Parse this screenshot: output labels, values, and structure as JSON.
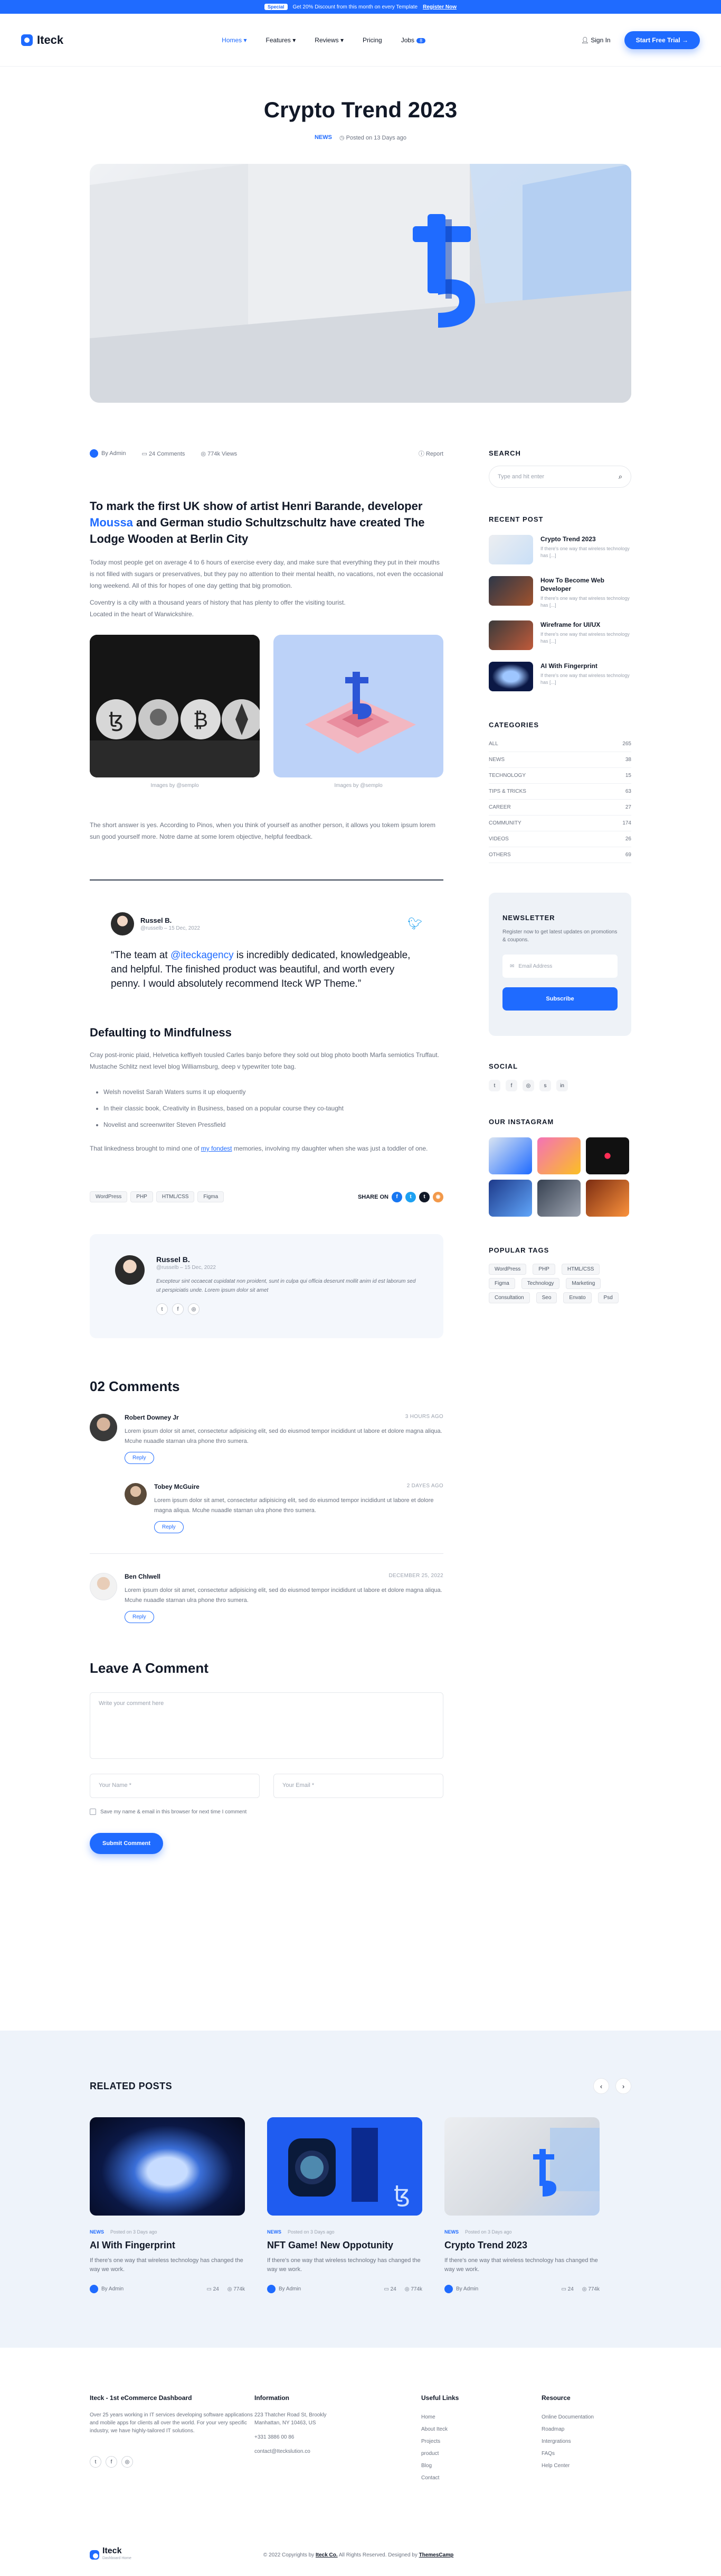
{
  "topbar": {
    "pill": "Special",
    "promo": "Get 20% Discount from this month on every Template",
    "cta": "Register Now"
  },
  "header": {
    "logo": "Iteck",
    "nav": [
      "Homes",
      "Features",
      "Reviews",
      "Pricing",
      "Jobs"
    ],
    "jobs_badge": "8",
    "signin": "Sign In",
    "cta": "Start Free Trial"
  },
  "post": {
    "title": "Crypto Trend 2023",
    "category": "NEWS",
    "posted": "Posted on 13 Days ago",
    "author": "By Admin",
    "comments": "24 Comments",
    "views": "774k Views",
    "report": "Report",
    "lead_a": "To mark the first UK show of artist Henri Barande, developer ",
    "lead_hl": "Moussa",
    "lead_b": " and German studio Schultzschultz have created The Lodge Wooden at Berlin City",
    "p1": "Today most people get on average 4 to 6 hours of exercise every day, and make sure that everything they put in their mouths is not filled with sugars or preservatives, but they pay no attention to their mental health, no vacations, not even the occasional long weekend. All of this for hopes of one day getting that big promotion.",
    "p2": "Coventry is a city with a thousand years of history that has plenty to offer the visiting tourist.",
    "p3": "Located in the heart of Warwickshire.",
    "caption1": "Images by @semplo",
    "caption2": "Images by @semplo",
    "p4": "The short answer is yes. According to Pinos, when you think of yourself as another person, it allows you tokem ipsum lorem sun good yourself more. Notre dame at some lorem objective, helpful feedback.",
    "quote_name": "Russel B.",
    "quote_sub": "@russelb – 15 Dec, 2022",
    "quote_a": "“The team at ",
    "quote_hl": "@iteckagency",
    "quote_b": " is incredibly dedicated, knowledgeable, and helpful. The finished product was beautiful, and worth every penny. I would absolutely recommend Iteck WP Theme.”",
    "section2": "Defaulting to Mindfulness",
    "p5": "Cray post-ironic plaid, Helvetica keffiyeh tousled Carles banjo before they sold out blog photo booth Marfa semiotics Truffaut. Mustache Schlitz next level blog Williamsburg, deep v typewriter tote bag.",
    "bullets": [
      "Welsh novelist Sarah Waters sums it up eloquently",
      "In their classic book, Creativity in Business, based on a popular course they co-taught",
      "Novelist and screenwriter Steven Pressfield"
    ],
    "p6_a": "That linkedness brought to mind one of ",
    "p6_link": "my fondest",
    "p6_b": " memories, involving my daughter when she was just a toddler of one.",
    "tags": [
      "WordPress",
      "PHP",
      "HTML/CSS",
      "Figma"
    ],
    "share_label": "SHARE ON",
    "author_box": {
      "name": "Russel B.",
      "sub": "@russelb – 15 Dec, 2022",
      "bio": "Excepteur sint occaecat cupidatat non proident, sunt in culpa qui officia deserunt mollit anim id est laborum sed ut perspiciatis unde. Lorem ipsum dolor sit amet"
    }
  },
  "comments": {
    "title": "02 Comments",
    "items": [
      {
        "name": "Robert Downey Jr",
        "time": "3 HOURS AGO",
        "text": "Lorem ipsum dolor sit amet, consectetur adipisicing elit, sed do eiusmod tempor incididunt ut labore et dolore magna aliqua. Mcuhe nuaadle starnan ulra phone thro sumera.",
        "reply": "Reply"
      },
      {
        "name": "Tobey McGuire",
        "time": "2 DAYES AGO",
        "text": "Lorem ipsum dolor sit amet, consectetur adipisicing elit, sed do eiusmod tempor incididunt ut labore et dolore magna aliqua. Mcuhe nuaadle starnan ulra phone thro sumera.",
        "reply": "Reply"
      },
      {
        "name": "Ben Chlwell",
        "time": "DECEMBER 25, 2022",
        "text": "Lorem ipsum dolor sit amet, consectetur adipisicing elit, sed do eiusmod tempor incididunt ut labore et dolore magna aliqua. Mcuhe nuaadle starnan ulra phone thro sumera.",
        "reply": "Reply"
      }
    ]
  },
  "form": {
    "title": "Leave A Comment",
    "comment_ph": "Write your comment here",
    "name_ph": "Your Name *",
    "email_ph": "Your Email *",
    "save": "Save my name & email in this browser for next time I comment",
    "submit": "Submit Comment"
  },
  "sidebar": {
    "search_title": "SEARCH",
    "search_ph": "Type and hit enter",
    "recent_title": "RECENT POST",
    "recent": [
      {
        "title": "Crypto Trend 2023",
        "desc": "If there's one way that wireless technology has [...]"
      },
      {
        "title": "How To Become Web Developer",
        "desc": "If there's one way that wireless technology has [...]"
      },
      {
        "title": "Wireframe for UI/UX",
        "desc": "If there's one way that wireless technology has [...]"
      },
      {
        "title": "AI With Fingerprint",
        "desc": "If there's one way that wireless technology has [...]"
      }
    ],
    "categories_title": "CATEGORIES",
    "categories": [
      {
        "name": "ALL",
        "count": "265"
      },
      {
        "name": "NEWS",
        "count": "38"
      },
      {
        "name": "TECHNOLOGY",
        "count": "15"
      },
      {
        "name": "TIPS & TRICKS",
        "count": "63"
      },
      {
        "name": "CAREER",
        "count": "27"
      },
      {
        "name": "COMMUNITY",
        "count": "174"
      },
      {
        "name": "VIDEOS",
        "count": "26"
      },
      {
        "name": "OTHERS",
        "count": "69"
      }
    ],
    "newsletter_title": "NEWSLETTER",
    "newsletter_text": "Register now to get latest updates on promotions & coupons.",
    "email_ph": "Email Address",
    "subscribe": "Subscribe",
    "social_title": "SOCIAL",
    "instagram_title": "OUR INSTAGRAM",
    "tags_title": "POPULAR TAGS",
    "tags": [
      "WordPress",
      "PHP",
      "HTML/CSS",
      "Figma",
      "Technology",
      "Marketing",
      "Consultation",
      "Seo",
      "Envato",
      "Psd"
    ]
  },
  "related": {
    "title": "RELATED POSTS",
    "items": [
      {
        "cat": "NEWS",
        "posted": "Posted on 3 Days ago",
        "title": "AI With Fingerprint",
        "desc": "If there's one way that wireless technology has changed the way we work.",
        "author": "By Admin",
        "comments": "24",
        "views": "774k"
      },
      {
        "cat": "NEWS",
        "posted": "Posted on 3 Days ago",
        "title": "NFT Game! New Oppotunity",
        "desc": "If there's one way that wireless technology has changed the way we work.",
        "author": "By Admin",
        "comments": "24",
        "views": "774k"
      },
      {
        "cat": "NEWS",
        "posted": "Posted on 3 Days ago",
        "title": "Crypto Trend 2023",
        "desc": "If there's one way that wireless technology has changed the way we work.",
        "author": "By Admin",
        "comments": "24",
        "views": "774k"
      }
    ]
  },
  "footer": {
    "about_title": "Iteck - 1st eCommerce Dashboard",
    "about_text": "Over 25 years working in IT services developing software applications and mobile apps for clients all over the world. For your very specific industry, we have highly-tailored IT solutions.",
    "info_title": "Information",
    "info": [
      "223 Thatcher Road St, Brookly Manhattan, NY 10463, US",
      "+331 3886 00 86",
      "contact@Iteckslution.co"
    ],
    "links_title": "Useful Links",
    "links": [
      "Home",
      "About Iteck",
      "Projects",
      "product",
      "Blog",
      "Contact"
    ],
    "resource_title": "Resource",
    "resources": [
      "Online Documentation",
      "Roadmap",
      "Intergrations",
      "FAQs",
      "Help Center"
    ],
    "copy_a": "© 2022 Copyrights by ",
    "copy_b": "Iteck Co.",
    "copy_c": " All Rights Reserved. Designed by ",
    "copy_d": "ThemesCamp",
    "logo_sub": "Dashboard Home"
  },
  "colors": {
    "brand": "#1f6bff",
    "dark": "#111827"
  }
}
